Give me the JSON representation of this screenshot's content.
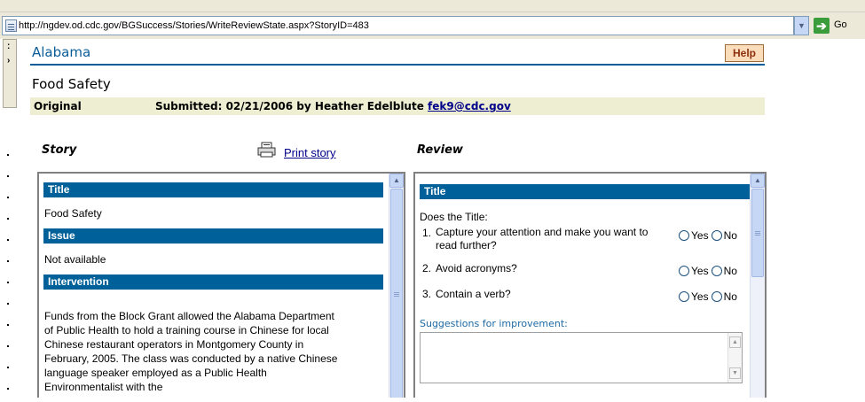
{
  "browser": {
    "url": "http://ngdev.od.cdc.gov/BGSuccess/Stories/WriteReviewState.aspx?StoryID=483",
    "go_label": "Go"
  },
  "page": {
    "state": "Alabama",
    "help_label": "Help",
    "story_title": "Food Safety",
    "version_label": "Original",
    "submitted_text": "Submitted: 02/21/2006 by Heather Edelblute",
    "submitter_email": "fek9@cdc.gov"
  },
  "story": {
    "heading": "Story",
    "print_label": "Print story",
    "sections": [
      {
        "label": "Title",
        "content": "Food Safety"
      },
      {
        "label": "Issue",
        "content": "Not available"
      },
      {
        "label": "Intervention",
        "content": "Funds from the Block Grant allowed the Alabama Department of Public Health to hold a training course in Chinese for local Chinese restaurant operators in Montgomery County in February, 2005. The class was conducted by a native Chinese language speaker employed as a Public Health Environmentalist with the"
      }
    ]
  },
  "review": {
    "heading": "Review",
    "section_label": "Title",
    "intro": "Does the Title:",
    "questions": [
      {
        "number": "1.",
        "text": "Capture your attention and make you want to read further?"
      },
      {
        "number": "2.",
        "text": "Avoid acronyms?"
      },
      {
        "number": "3.",
        "text": "Contain a verb?"
      }
    ],
    "yes_label": "Yes",
    "no_label": "No",
    "suggestions_label": "Suggestions for improvement:",
    "suggestions_value": ""
  },
  "icons": [
    "page-icon",
    "dropdown-arrow-icon",
    "go-arrow-icon",
    "printer-icon",
    "scroll-up-icon",
    "scroll-down-icon"
  ]
}
